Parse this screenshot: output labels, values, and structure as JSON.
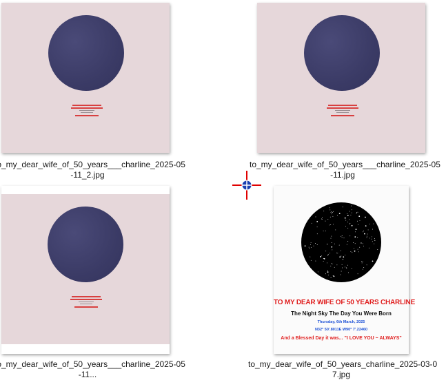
{
  "files": [
    {
      "caption_line1": "to_my_dear_wife_of_50_years___charline_2025-05",
      "caption_line2": "-11_2.jpg"
    },
    {
      "caption_line1": "to_my_dear_wife_of_50_years___charline_2025-05",
      "caption_line2": "-11.jpg"
    },
    {
      "caption_line1": "to_my_dear_wife_of_50_years___charline_2025-05",
      "caption_line2": "-11..."
    },
    {
      "caption_line1": "to_my_dear_wife_of_50_years_charline_2025-03-0",
      "caption_line2": "7.jpg",
      "poster": {
        "title": "TO MY DEAR WIFE OF 50 YEARS CHARLINE",
        "subtitle": "The Night Sky The Day You Were Born",
        "date": "Thursday, 6th March, 2025",
        "coords": "N32° 50'.8011E W90° 7'.22460",
        "closing": "And a Blessed Day it was... \"I LOVE YOU ~ ALWAYS\""
      }
    }
  ],
  "colors": {
    "thumb_pink": "#e6d7da",
    "circle_navy": "#3b3b66",
    "poster_red": "#e02020",
    "poster_blue": "#1a4fd6",
    "cursor_red": "#e00000",
    "cursor_blue": "#1a3fb0"
  },
  "cursor": {
    "icon": "crosshair-move-cursor-icon"
  }
}
